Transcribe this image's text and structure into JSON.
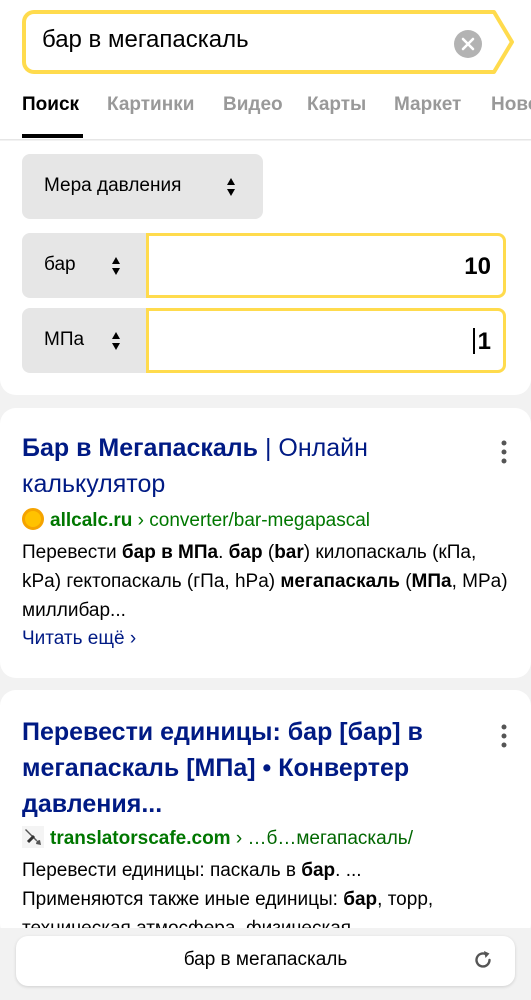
{
  "search": {
    "query": "бар в мегапаскаль"
  },
  "tabs": [
    {
      "label": "Поиск"
    },
    {
      "label": "Картинки"
    },
    {
      "label": "Видео"
    },
    {
      "label": "Карты"
    },
    {
      "label": "Маркет"
    },
    {
      "label": "Новости"
    }
  ],
  "converter": {
    "category": "Мера давления",
    "from_unit": "бар",
    "from_value": "10",
    "to_unit": "МПа",
    "to_value": "1"
  },
  "results": [
    {
      "title_bold": "Бар в Мегапаскаль",
      "title_rest": " | Онлайн калькулятор",
      "domain": "allcalc.ru",
      "path": " › converter/bar-megapascal",
      "snippet_parts": [
        "Перевести ",
        "бар в МПа",
        ". ",
        "бар",
        " (",
        "bar",
        ") килопаскаль (кПа, kPa) гектопаскаль (гПа, hPa) ",
        "мегапаскаль",
        " (",
        "МПа",
        ", MPa) миллибар..."
      ],
      "read_more": "Читать ещё ›"
    },
    {
      "title": "Перевести единицы: бар [бар] в мегапаскаль [МПа] • Конвертер давления...",
      "domain": "translatorscafe.com",
      "path": " › …б…мегапаскаль/",
      "snippet_line1_a": "Перевести единицы: паскаль в ",
      "snippet_line1_b": "бар",
      "snippet_line1_c": ". ...",
      "snippet_line2_a": "Применяются также иные единицы: ",
      "snippet_line2_b": "бар",
      "snippet_line2_c": ", торр,",
      "snippet_line3": "техническая атмосфера, физическая"
    }
  ],
  "bottom_bar": {
    "query": "бар в мегапаскаль"
  },
  "colors": {
    "accent": "#ffdb4d",
    "link": "#001a84",
    "url": "#007700"
  }
}
